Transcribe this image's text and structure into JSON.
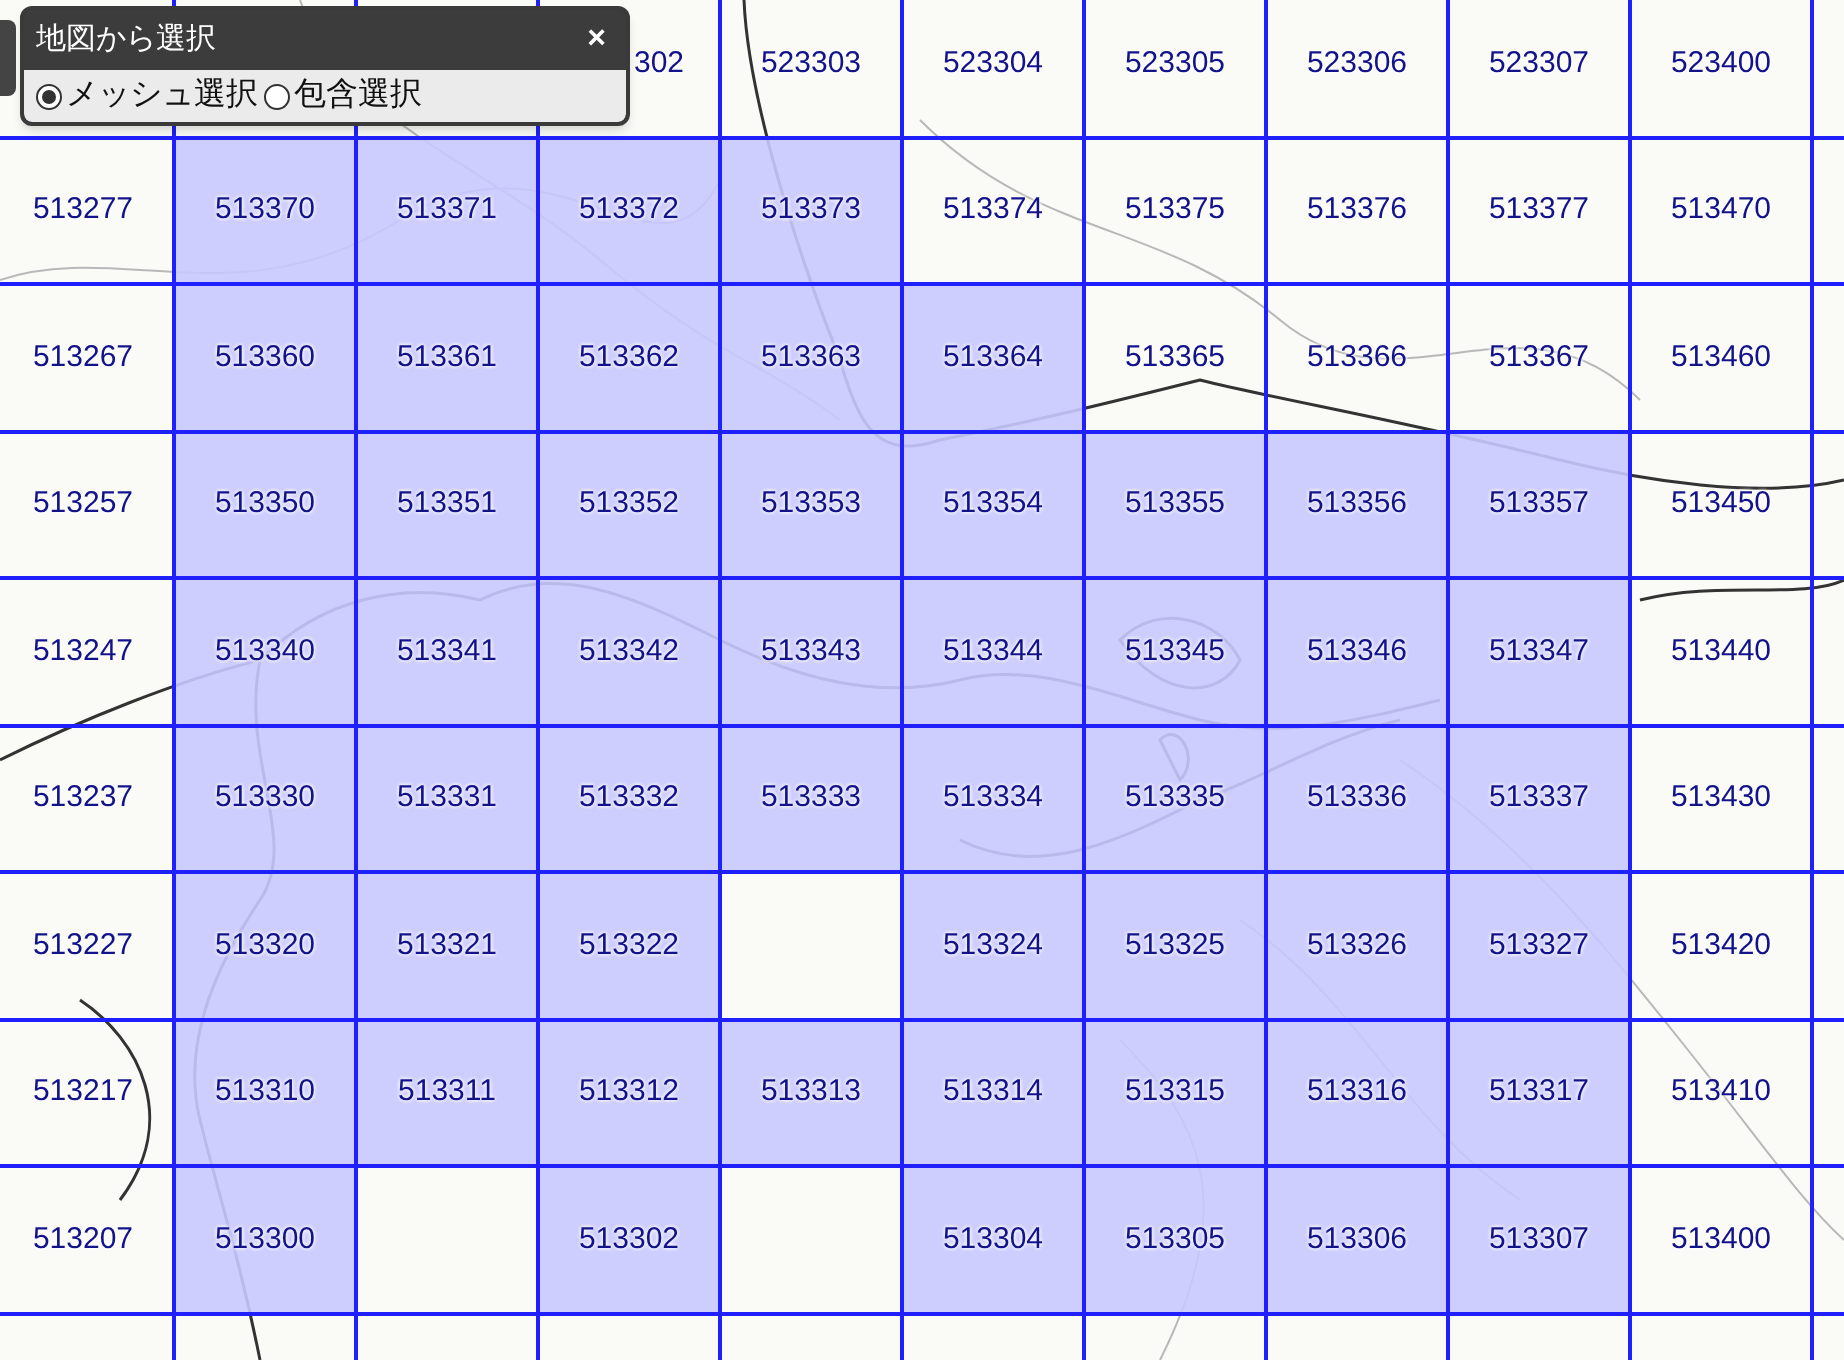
{
  "panel": {
    "title": "地図から選択",
    "close": "×",
    "options": [
      {
        "label": "メッシュ選択",
        "selected": true
      },
      {
        "label": "包含選択",
        "selected": false
      }
    ]
  },
  "grid": {
    "rows": [
      [
        {
          "selected": false
        },
        {
          "selected": false
        },
        {
          "selected": false
        },
        {
          "code": "302",
          "selected": false
        },
        {
          "code": "523303",
          "selected": false
        },
        {
          "code": "523304",
          "selected": false
        },
        {
          "code": "523305",
          "selected": false
        },
        {
          "code": "523306",
          "selected": false
        },
        {
          "code": "523307",
          "selected": false
        },
        {
          "code": "523400",
          "selected": false
        }
      ],
      [
        {
          "code": "513277",
          "selected": false
        },
        {
          "code": "513370",
          "selected": true
        },
        {
          "code": "513371",
          "selected": true
        },
        {
          "code": "513372",
          "selected": true
        },
        {
          "code": "513373",
          "selected": true
        },
        {
          "code": "513374",
          "selected": false
        },
        {
          "code": "513375",
          "selected": false
        },
        {
          "code": "513376",
          "selected": false
        },
        {
          "code": "513377",
          "selected": false
        },
        {
          "code": "513470",
          "selected": false
        }
      ],
      [
        {
          "code": "513267",
          "selected": false
        },
        {
          "code": "513360",
          "selected": true
        },
        {
          "code": "513361",
          "selected": true
        },
        {
          "code": "513362",
          "selected": true
        },
        {
          "code": "513363",
          "selected": true
        },
        {
          "code": "513364",
          "selected": true
        },
        {
          "code": "513365",
          "selected": false
        },
        {
          "code": "513366",
          "selected": false
        },
        {
          "code": "513367",
          "selected": false
        },
        {
          "code": "513460",
          "selected": false
        }
      ],
      [
        {
          "code": "513257",
          "selected": false
        },
        {
          "code": "513350",
          "selected": true
        },
        {
          "code": "513351",
          "selected": true
        },
        {
          "code": "513352",
          "selected": true
        },
        {
          "code": "513353",
          "selected": true
        },
        {
          "code": "513354",
          "selected": true
        },
        {
          "code": "513355",
          "selected": true
        },
        {
          "code": "513356",
          "selected": true
        },
        {
          "code": "513357",
          "selected": true
        },
        {
          "code": "513450",
          "selected": false
        }
      ],
      [
        {
          "code": "513247",
          "selected": false
        },
        {
          "code": "513340",
          "selected": true
        },
        {
          "code": "513341",
          "selected": true
        },
        {
          "code": "513342",
          "selected": true
        },
        {
          "code": "513343",
          "selected": true
        },
        {
          "code": "513344",
          "selected": true
        },
        {
          "code": "513345",
          "selected": true
        },
        {
          "code": "513346",
          "selected": true
        },
        {
          "code": "513347",
          "selected": true
        },
        {
          "code": "513440",
          "selected": false
        }
      ],
      [
        {
          "code": "513237",
          "selected": false
        },
        {
          "code": "513330",
          "selected": true
        },
        {
          "code": "513331",
          "selected": true
        },
        {
          "code": "513332",
          "selected": true
        },
        {
          "code": "513333",
          "selected": true
        },
        {
          "code": "513334",
          "selected": true
        },
        {
          "code": "513335",
          "selected": true
        },
        {
          "code": "513336",
          "selected": true
        },
        {
          "code": "513337",
          "selected": true
        },
        {
          "code": "513430",
          "selected": false
        }
      ],
      [
        {
          "code": "513227",
          "selected": false
        },
        {
          "code": "513320",
          "selected": true
        },
        {
          "code": "513321",
          "selected": true
        },
        {
          "code": "513322",
          "selected": true
        },
        {
          "selected": false
        },
        {
          "code": "513324",
          "selected": true
        },
        {
          "code": "513325",
          "selected": true
        },
        {
          "code": "513326",
          "selected": true
        },
        {
          "code": "513327",
          "selected": true
        },
        {
          "code": "513420",
          "selected": false
        }
      ],
      [
        {
          "code": "513217",
          "selected": false
        },
        {
          "code": "513310",
          "selected": true
        },
        {
          "code": "513311",
          "selected": true
        },
        {
          "code": "513312",
          "selected": true
        },
        {
          "code": "513313",
          "selected": true
        },
        {
          "code": "513314",
          "selected": true
        },
        {
          "code": "513315",
          "selected": true
        },
        {
          "code": "513316",
          "selected": true
        },
        {
          "code": "513317",
          "selected": true
        },
        {
          "code": "513410",
          "selected": false
        }
      ],
      [
        {
          "code": "513207",
          "selected": false
        },
        {
          "code": "513300",
          "selected": true
        },
        {
          "selected": false
        },
        {
          "code": "513302",
          "selected": true
        },
        {
          "selected": false
        },
        {
          "code": "513304",
          "selected": true
        },
        {
          "code": "513305",
          "selected": true
        },
        {
          "code": "513306",
          "selected": true
        },
        {
          "code": "513307",
          "selected": true
        },
        {
          "code": "513400",
          "selected": false
        }
      ],
      [
        {
          "selected": false
        },
        {
          "selected": false
        },
        {
          "selected": false
        },
        {
          "selected": false
        },
        {
          "selected": false
        },
        {
          "selected": false
        },
        {
          "selected": false
        },
        {
          "selected": false
        },
        {
          "selected": false
        },
        {
          "selected": false
        }
      ]
    ]
  }
}
